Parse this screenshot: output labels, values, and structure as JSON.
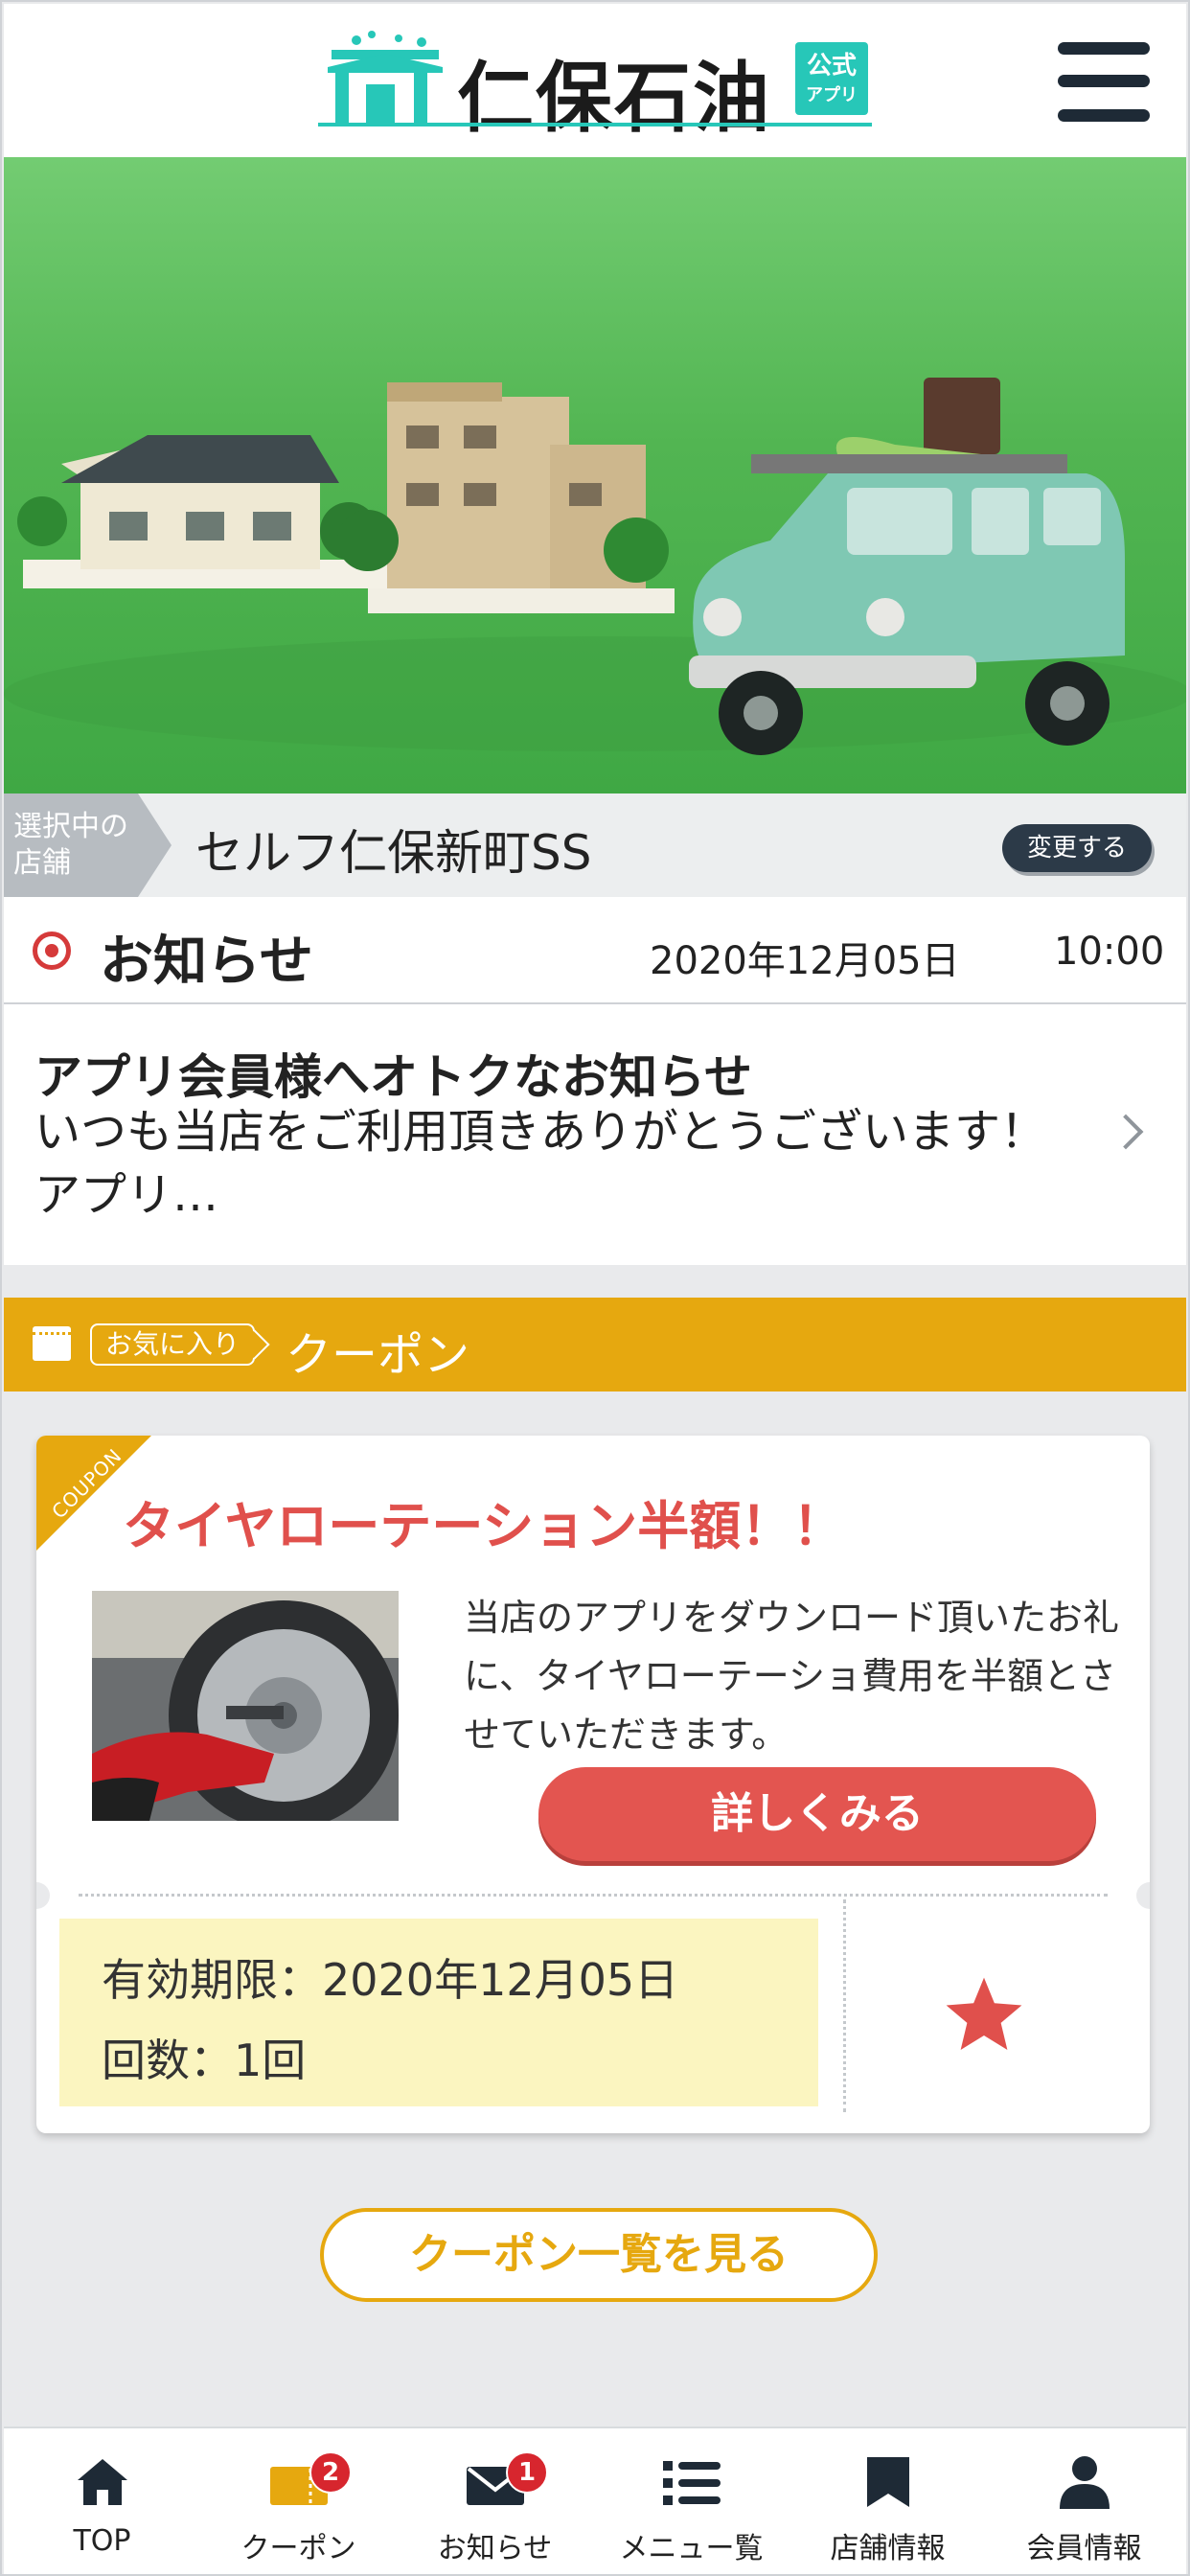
{
  "header": {
    "logo_text": "仁保石油",
    "logo_badge_line1": "公式",
    "logo_badge_line2": "アプリ"
  },
  "store": {
    "tag": "選択中の店舗",
    "name": "セルフ仁保新町SS",
    "change_label": "変更する"
  },
  "notice": {
    "title": "お知らせ",
    "date": "2020年12月05日",
    "time": "10:00",
    "item_title": "アプリ会員様へオトクなお知らせ",
    "item_text": "いつも当店をご利用頂きありがとうございます！アプリ…"
  },
  "coupon_section": {
    "favorite_tag": "お気に入り",
    "label": "クーポン"
  },
  "coupon": {
    "corner_label": "COUPON",
    "title": "タイヤローテーション半額！！",
    "description": "当店のアプリをダウンロード頂いたお礼に、タイヤローテーショ費用を半額とさせていただきます。",
    "detail_button": "詳しくみる",
    "expiry": "有効期限：2020年12月05日",
    "count": "回数：1回"
  },
  "coupon_list_button": "クーポン一覧を見る",
  "tabbar": {
    "items": [
      {
        "label": "TOP",
        "icon": "home-icon"
      },
      {
        "label": "クーポン",
        "icon": "coupon-icon",
        "badge": "2"
      },
      {
        "label": "お知らせ",
        "icon": "mail-icon",
        "badge": "1"
      },
      {
        "label": "メニュー覧",
        "icon": "list-icon"
      },
      {
        "label": "店舗情報",
        "icon": "store-icon"
      },
      {
        "label": "会員情報",
        "icon": "person-icon"
      }
    ]
  },
  "colors": {
    "accent_teal": "#27c7b8",
    "coupon_gold": "#e6a80f",
    "coupon_red": "#e35550",
    "navy": "#1e2a36"
  }
}
